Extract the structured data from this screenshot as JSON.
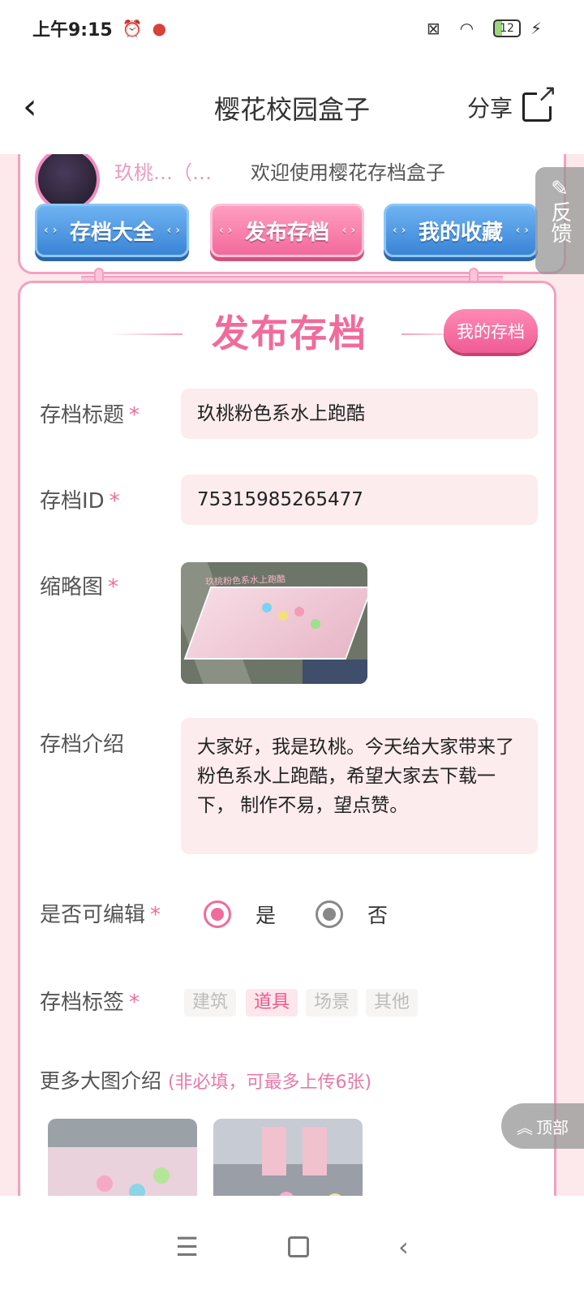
{
  "status": {
    "time": "上午9:15",
    "battery": "12"
  },
  "topbar": {
    "title": "樱花校园盒子",
    "share_label": "分享"
  },
  "user": {
    "name": "玖桃…（…",
    "welcome": "欢迎使用樱花存档盒子"
  },
  "menu": {
    "all": "存档大全",
    "publish": "发布存档",
    "favorites": "我的收藏"
  },
  "form": {
    "title": "发布存档",
    "my_archive_button": "我的存档",
    "required_mark": "*",
    "archive_title_label": "存档标题",
    "archive_title_value": "玖桃粉色系水上跑酷",
    "archive_id_label": "存档ID",
    "archive_id_value": "75315985265477",
    "thumbnail_label": "缩略图",
    "thumbnail_caption": "玖桃粉色系水上跑酷",
    "intro_label": "存档介绍",
    "intro_value": "大家好，我是玖桃。今天给大家带来了粉色系水上跑酷，希望大家去下载一下， 制作不易，望点赞。",
    "editable_label": "是否可编辑",
    "editable_yes": "是",
    "editable_no": "否",
    "editable_selected": "是",
    "tags_label": "存档标签",
    "tags": [
      "建筑",
      "道具",
      "场景",
      "其他"
    ],
    "tags_selected": "道具",
    "more_images_label": "更多大图介绍",
    "more_images_note": "(非必填，可最多上传6张)"
  },
  "floating": {
    "feedback": "反馈",
    "top": "顶部"
  },
  "colors": {
    "accent": "#f06b9c",
    "blue": "#3a84d6",
    "background": "#fde9ec"
  }
}
